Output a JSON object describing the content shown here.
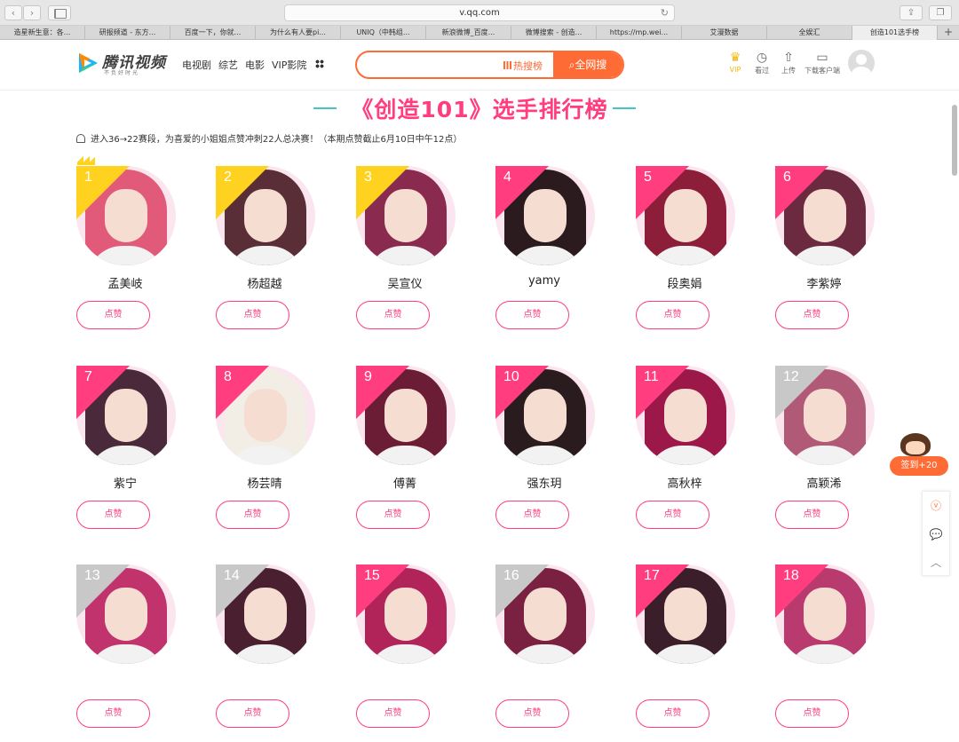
{
  "browser": {
    "url": "v.qq.com",
    "tabs": [
      {
        "label": "造星新生意：各..."
      },
      {
        "label": "研报频道 - 东方..."
      },
      {
        "label": "百度一下，你就..."
      },
      {
        "label": "为什么有人要pi..."
      },
      {
        "label": "UNIQ（中韩组..."
      },
      {
        "label": "新浪微博_百度..."
      },
      {
        "label": "微博搜索 - 创造..."
      },
      {
        "label": "https://mp.wei..."
      },
      {
        "label": "艾漫数据"
      },
      {
        "label": "全娱汇"
      },
      {
        "label": "创造101选手榜"
      }
    ],
    "new_tab": "+"
  },
  "header": {
    "logo_text": "腾讯视频",
    "logo_slogan": "不负好时光",
    "nav": [
      "电视剧",
      "综艺",
      "电影",
      "VIP影院"
    ],
    "search_placeholder": "",
    "hot_list": "热搜榜",
    "search_all": "全网搜",
    "icons": [
      {
        "name": "vip",
        "label": "VIP"
      },
      {
        "name": "history",
        "label": "看过"
      },
      {
        "name": "upload",
        "label": "上传"
      },
      {
        "name": "client",
        "label": "下载客户端"
      }
    ]
  },
  "page": {
    "title": "《创造101》选手排行榜",
    "notice": "进入36→22赛段，为喜爱的小姐姐点赞冲刺22人总决赛！（本期点赞截止6月10日中午12点）",
    "like_label": "点赞",
    "contestants": [
      {
        "rank": "1",
        "name": "孟美岐"
      },
      {
        "rank": "2",
        "name": "杨超越"
      },
      {
        "rank": "3",
        "name": "吴宣仪"
      },
      {
        "rank": "4",
        "name": "yamy"
      },
      {
        "rank": "5",
        "name": "段奥娟"
      },
      {
        "rank": "6",
        "name": "李紫婷"
      },
      {
        "rank": "7",
        "name": "紫宁"
      },
      {
        "rank": "8",
        "name": "杨芸晴"
      },
      {
        "rank": "9",
        "name": "傅菁"
      },
      {
        "rank": "10",
        "name": "强东玥"
      },
      {
        "rank": "11",
        "name": "高秋梓"
      },
      {
        "rank": "12",
        "name": "高颖浠"
      },
      {
        "rank": "13",
        "name": ""
      },
      {
        "rank": "14",
        "name": ""
      },
      {
        "rank": "15",
        "name": ""
      },
      {
        "rank": "16",
        "name": ""
      },
      {
        "rank": "17",
        "name": ""
      },
      {
        "rank": "18",
        "name": ""
      }
    ]
  },
  "signin": {
    "label": "签到+20"
  },
  "colors": {
    "accent": "#ff6b35",
    "pink": "#ff3d7f",
    "gold": "#ffd21f",
    "gray_rank": "#c8c8c8",
    "teal": "#44c5c5"
  }
}
